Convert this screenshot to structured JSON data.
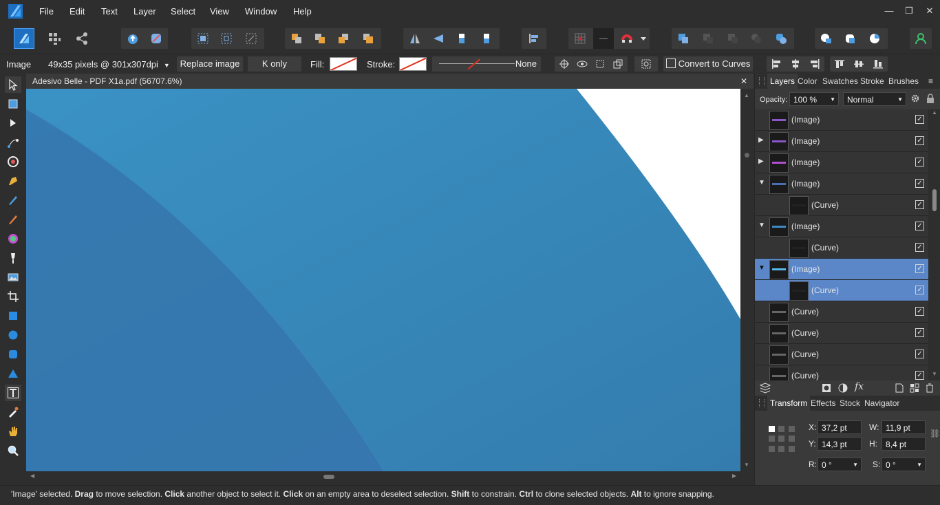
{
  "menu": {
    "items": [
      "File",
      "Edit",
      "Text",
      "Layer",
      "Select",
      "View",
      "Window",
      "Help"
    ]
  },
  "window_controls": {
    "minimize": "—",
    "restore": "❐",
    "close": "✕"
  },
  "context": {
    "object_type": "Image",
    "image_info": "49x35 pixels @ 301x307dpi",
    "replace_image": "Replace image",
    "k_only": "K only",
    "fill_label": "Fill:",
    "stroke_label": "Stroke:",
    "stroke_value": "None",
    "convert_to_curves": "Convert to Curves"
  },
  "document": {
    "title": "Adesivo Belle - PDF X1a.pdf (56707.6%)",
    "close": "✕"
  },
  "panels": {
    "top_tabs": [
      "Layers",
      "Color",
      "Swatches",
      "Stroke",
      "Brushes"
    ],
    "opacity_label": "Opacity:",
    "opacity_value": "100 %",
    "blend_mode": "Normal",
    "layers": [
      {
        "label": "(Image)",
        "indent": 0,
        "expander": "",
        "selected": false
      },
      {
        "label": "(Image)",
        "indent": 0,
        "expander": "right",
        "selected": false
      },
      {
        "label": "(Image)",
        "indent": 0,
        "expander": "right",
        "selected": false
      },
      {
        "label": "(Image)",
        "indent": 0,
        "expander": "down",
        "selected": false
      },
      {
        "label": "(Curve)",
        "indent": 1,
        "expander": "",
        "selected": false
      },
      {
        "label": "(Image)",
        "indent": 0,
        "expander": "down",
        "selected": false
      },
      {
        "label": "(Curve)",
        "indent": 1,
        "expander": "",
        "selected": false
      },
      {
        "label": "(Image)",
        "indent": 0,
        "expander": "down",
        "selected": true
      },
      {
        "label": "(Curve)",
        "indent": 1,
        "expander": "",
        "selected": true
      },
      {
        "label": "(Curve)",
        "indent": 0,
        "expander": "",
        "selected": false
      },
      {
        "label": "(Curve)",
        "indent": 0,
        "expander": "",
        "selected": false
      },
      {
        "label": "(Curve)",
        "indent": 0,
        "expander": "",
        "selected": false
      },
      {
        "label": "(Curve)",
        "indent": 0,
        "expander": "",
        "selected": false
      }
    ],
    "bottom_tabs": [
      "Transform",
      "Effects",
      "Stock",
      "Navigator"
    ],
    "transform": {
      "x_label": "X:",
      "x": "37,2 pt",
      "y_label": "Y:",
      "y": "14,3 pt",
      "w_label": "W:",
      "w": "11,9 pt",
      "h_label": "H:",
      "h": "8,4 pt",
      "r_label": "R:",
      "r": "0 °",
      "s_label": "S:",
      "s": "0 °"
    }
  },
  "status": {
    "parts": [
      {
        "t": "'Image' selected. ",
        "b": false
      },
      {
        "t": "Drag",
        "b": true
      },
      {
        "t": " to move selection. ",
        "b": false
      },
      {
        "t": "Click",
        "b": true
      },
      {
        "t": " another object to select it. ",
        "b": false
      },
      {
        "t": "Click",
        "b": true
      },
      {
        "t": " on an empty area to deselect selection. ",
        "b": false
      },
      {
        "t": "Shift",
        "b": true
      },
      {
        "t": " to constrain. ",
        "b": false
      },
      {
        "t": "Ctrl",
        "b": true
      },
      {
        "t": " to clone selected objects. ",
        "b": false
      },
      {
        "t": "Alt",
        "b": true
      },
      {
        "t": " to ignore snapping.",
        "b": false
      }
    ]
  },
  "colors": {
    "accent": "#5b87c9",
    "canvas_blue": "#3580b3",
    "app_bg": "#2e2e2e",
    "logo_blue": "#2a8ce0"
  }
}
